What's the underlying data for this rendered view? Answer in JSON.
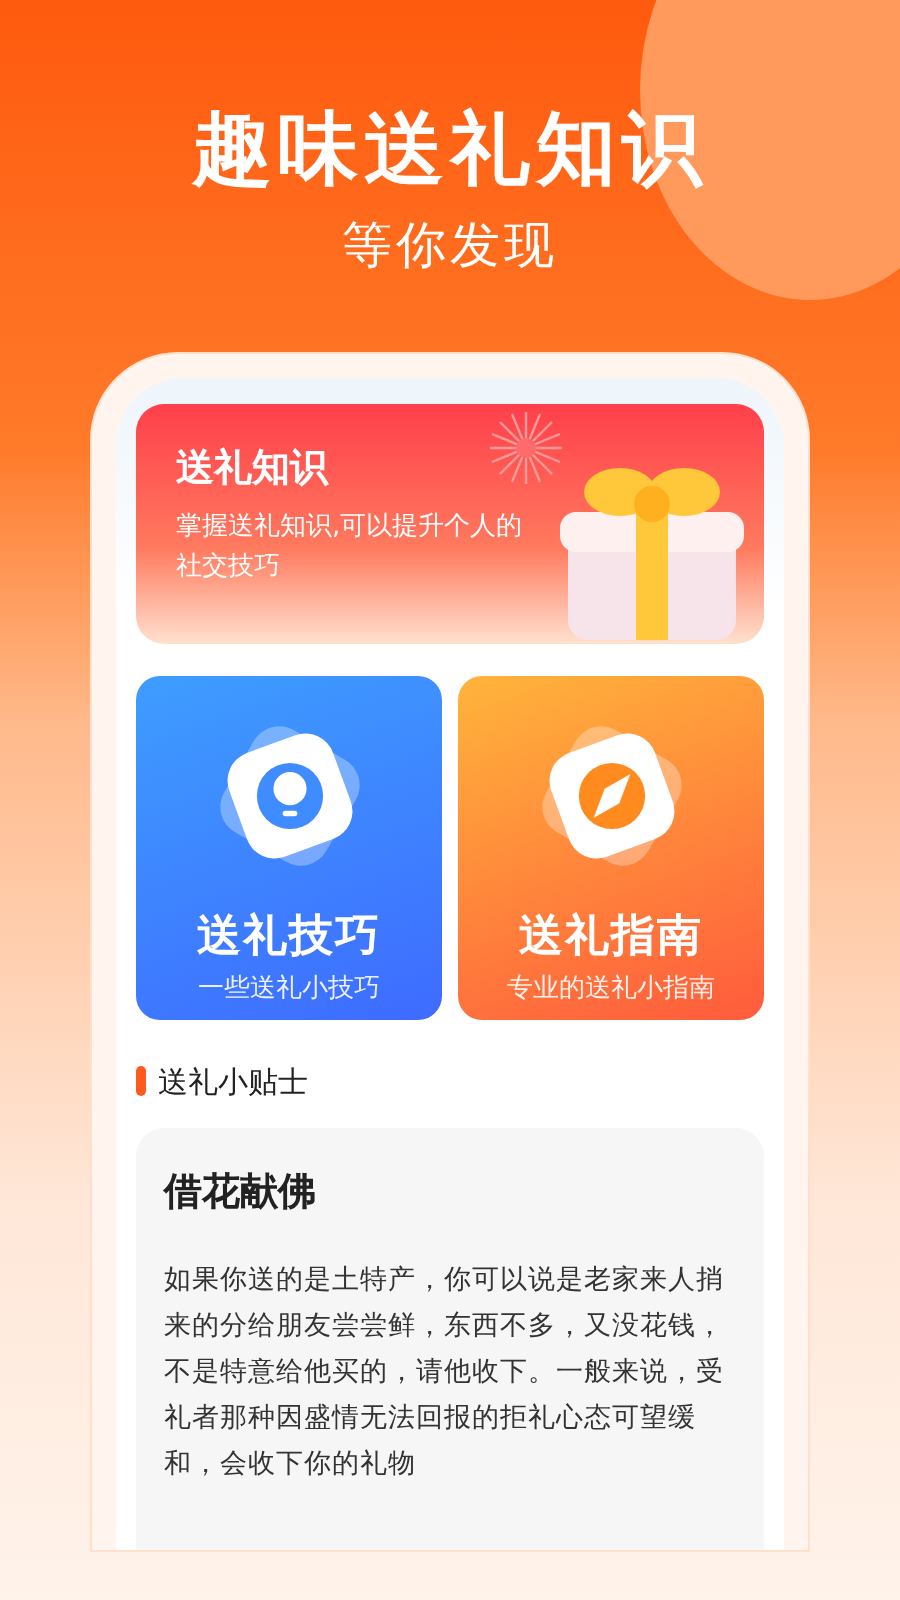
{
  "hero": {
    "title": "趣味送礼知识",
    "subtitle": "等你发现"
  },
  "banner": {
    "title": "送礼知识",
    "text": "掌握送礼知识,可以提升个人的社交技巧"
  },
  "tiles": [
    {
      "kind": "tips",
      "title": "送礼技巧",
      "subtitle": "一些送礼小技巧"
    },
    {
      "kind": "guide",
      "title": "送礼指南",
      "subtitle": "专业的送礼小指南"
    }
  ],
  "section": {
    "title": "送礼小贴士"
  },
  "tip": {
    "title": "借花献佛",
    "body": "如果你送的是土特产，你可以说是老家来人捎来的分给朋友尝尝鲜，东西不多，又没花钱，不是特意给他买的，请他收下。一般来说，受礼者那种因盛情无法回报的拒礼心态可望缓和，会收下你的礼物"
  }
}
